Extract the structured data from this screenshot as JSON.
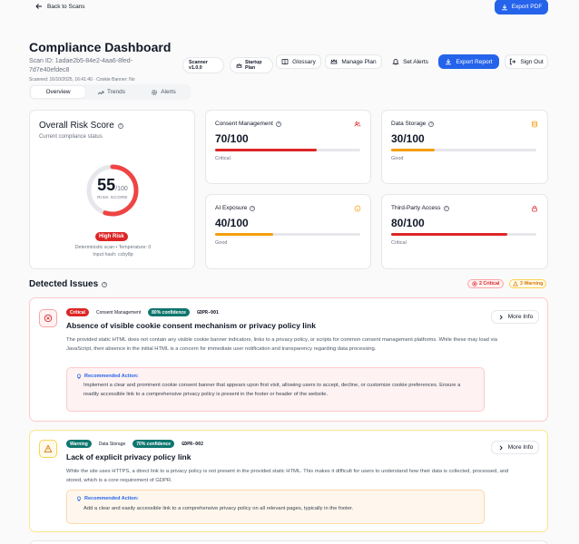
{
  "top": {
    "back_label": "Back to Scans",
    "export_pdf_label": "Export PDF"
  },
  "header": {
    "title": "Compliance Dashboard",
    "scan_id_line1": "Scan ID: 1adae2b5-84e2-4aa6-8fed-",
    "scan_id_line2": "7d7e40efdec8",
    "scanned_meta": "Scanned: 16/10/2025, 16:41:40 · Cookie Banner: No",
    "scanner_badge_line1": "Scanner",
    "scanner_badge_line2": "v1.0.0",
    "plan_badge_line1": "Startup",
    "plan_badge_line2": "Plan",
    "glossary_label": "Glossary",
    "manage_plan_label": "Manage Plan",
    "set_alerts_label": "Set Alerts",
    "export_report_label": "Export Report",
    "sign_out_label": "Sign Out"
  },
  "tabs": [
    {
      "label": "Overview",
      "active": true
    },
    {
      "label": "Trends",
      "active": false
    },
    {
      "label": "Alerts",
      "active": false
    }
  ],
  "risk": {
    "title": "Overall Risk Score",
    "subtitle": "Current compliance status",
    "score": "55",
    "max": "/100",
    "score_fraction": 0.55,
    "score_label": "RISK SCORE",
    "level": "High Risk",
    "note1": "Deterministic scan • Temperature: 0",
    "note2": "Input hash: ccby8p"
  },
  "metrics": [
    {
      "title": "Consent Management",
      "value": "70/100",
      "fill": 0.7,
      "color": "#dc2626",
      "status": "Critical",
      "icon": "users-icon"
    },
    {
      "title": "Data Storage",
      "value": "30/100",
      "fill": 0.3,
      "color": "#f59e0b",
      "status": "Good",
      "icon": "database-icon"
    },
    {
      "title": "AI Exposure",
      "value": "40/100",
      "fill": 0.4,
      "color": "#f59e0b",
      "status": "Good",
      "icon": "info-icon"
    },
    {
      "title": "Third-Party Access",
      "value": "80/100",
      "fill": 0.8,
      "color": "#dc2626",
      "status": "Critical",
      "icon": "lock-icon"
    }
  ],
  "issues_section": {
    "title": "Detected Issues",
    "critical_count": "2 Critical",
    "warning_count": "3 Warning"
  },
  "issues": [
    {
      "severity": "Critical",
      "category": "Consent Management",
      "confidence": "80% confidence",
      "code": "GDPR-001",
      "title": "Absence of visible cookie consent mechanism or privacy policy link",
      "description": "The provided static HTML does not contain any visible cookie banner indicators, links to a privacy policy, or scripts for common consent management platforms. While these may load via JavaScript, their absence in the initial HTML is a concern for immediate user notification and transparency regarding data processing.",
      "action_title": "Recommended Action:",
      "action": "Implement a clear and prominent cookie consent banner that appears upon first visit, allowing users to accept, decline, or customize cookie preferences. Ensure a readily accessible link to a comprehensive privacy policy is present in the footer or header of the website.",
      "more_info": "More Info"
    },
    {
      "severity": "Warning",
      "category": "Data Storage",
      "confidence": "70% confidence",
      "code": "GDPR-002",
      "title": "Lack of explicit privacy policy link",
      "description": "While the site uses HTTPS, a direct link to a privacy policy is not present in the provided static HTML. This makes it difficult for users to understand how their data is collected, processed, and stored, which is a core requirement of GDPR.",
      "action_title": "Recommended Action:",
      "action": "Add a clear and easily accessible link to a comprehensive privacy policy on all relevant pages, typically in the footer.",
      "more_info": "More Info"
    }
  ],
  "colors": {
    "primary": "#2563eb",
    "critical": "#dc2626",
    "warning": "#f59e0b",
    "confidence": "#0f766e"
  }
}
